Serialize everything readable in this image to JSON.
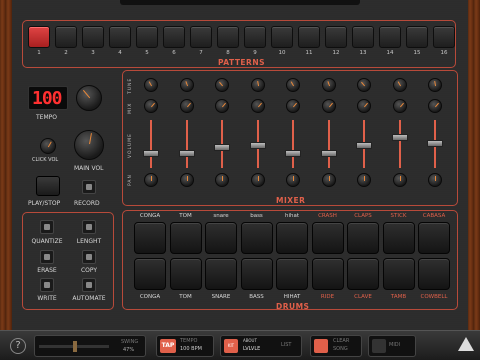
{
  "patterns": {
    "title": "PATTERNS",
    "buttons": [
      "1",
      "2",
      "3",
      "4",
      "5",
      "6",
      "7",
      "8",
      "9",
      "10",
      "11",
      "12",
      "13",
      "14",
      "15",
      "16"
    ],
    "active_index": 0
  },
  "tempo": {
    "display": "100",
    "label": "TEMPO"
  },
  "controls": {
    "click_vol_label": "CLICK VOL",
    "main_vol_label": "MAIN VOL",
    "play_stop_label": "PLAY/STOP",
    "record_label": "RECORD"
  },
  "mixer": {
    "title": "MIXER",
    "row_labels": [
      "TUNE",
      "MIX",
      "VOLUME",
      "PAN"
    ],
    "channels": [
      "CONGA",
      "TOM",
      "snare",
      "bass",
      "hihat",
      "CRASH",
      "CLAPS",
      "STICK",
      "CABASA"
    ]
  },
  "functions": {
    "quantize": "QUANTIZE",
    "lenght": "LENGHT",
    "erase": "ERASE",
    "copy": "COPY",
    "write": "WRITE",
    "automate": "AUTOMATE"
  },
  "drums": {
    "title": "DRUMS",
    "top_labels": [
      "CONGA",
      "TOM",
      "snare",
      "bass",
      "hihat",
      "CRASH",
      "CLAPS",
      "STICK",
      "CABASA"
    ],
    "bottom_labels": [
      "CONGA",
      "TOM",
      "SNARE",
      "BASS",
      "HIHAT",
      "RIDE",
      "CLAVE",
      "TAMB",
      "COWBELL"
    ]
  },
  "bottombar": {
    "help": "?",
    "swing_label": "SWING",
    "swing_value": "47%",
    "tap_label": "TAP",
    "tempo_label": "TEMPO",
    "tempo_value": "100 BPM",
    "kit_label": "KIT",
    "kit_value": "ABOUT",
    "kit_sub": "LVLVLE",
    "list_label": "LIST",
    "clear_label": "CLEAR",
    "song_label": "SONG",
    "midi_label": "MIDI",
    "accent_color": "#e0604a"
  }
}
